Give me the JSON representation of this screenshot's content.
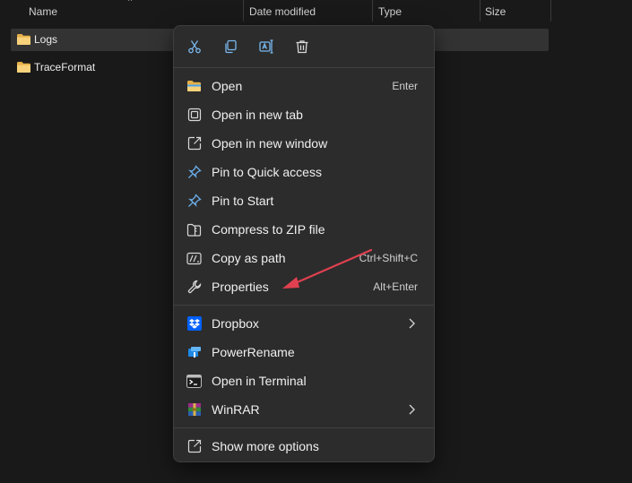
{
  "columns": {
    "name": "Name",
    "date_modified": "Date modified",
    "type": "Type",
    "size": "Size"
  },
  "files": [
    {
      "name": "Logs"
    },
    {
      "name": "TraceFormat"
    }
  ],
  "quick_actions": [
    "cut-icon",
    "copy-icon",
    "rename-icon",
    "delete-icon"
  ],
  "menu": {
    "open": {
      "label": "Open",
      "shortcut": "Enter"
    },
    "open_new_tab": {
      "label": "Open in new tab"
    },
    "open_new_window": {
      "label": "Open in new window"
    },
    "pin_quick_access": {
      "label": "Pin to Quick access"
    },
    "pin_start": {
      "label": "Pin to Start"
    },
    "compress_zip": {
      "label": "Compress to ZIP file"
    },
    "copy_path": {
      "label": "Copy as path",
      "shortcut": "Ctrl+Shift+C"
    },
    "properties": {
      "label": "Properties",
      "shortcut": "Alt+Enter"
    },
    "dropbox": {
      "label": "Dropbox"
    },
    "powerrename": {
      "label": "PowerRename"
    },
    "open_terminal": {
      "label": "Open in Terminal"
    },
    "winrar": {
      "label": "WinRAR"
    },
    "show_more": {
      "label": "Show more options"
    }
  },
  "colors": {
    "background": "#191919",
    "menu_bg": "#2c2c2c",
    "folder": "#f2c55c",
    "accent_blue": "#4aa3f0",
    "arrow": "#e0404f"
  }
}
